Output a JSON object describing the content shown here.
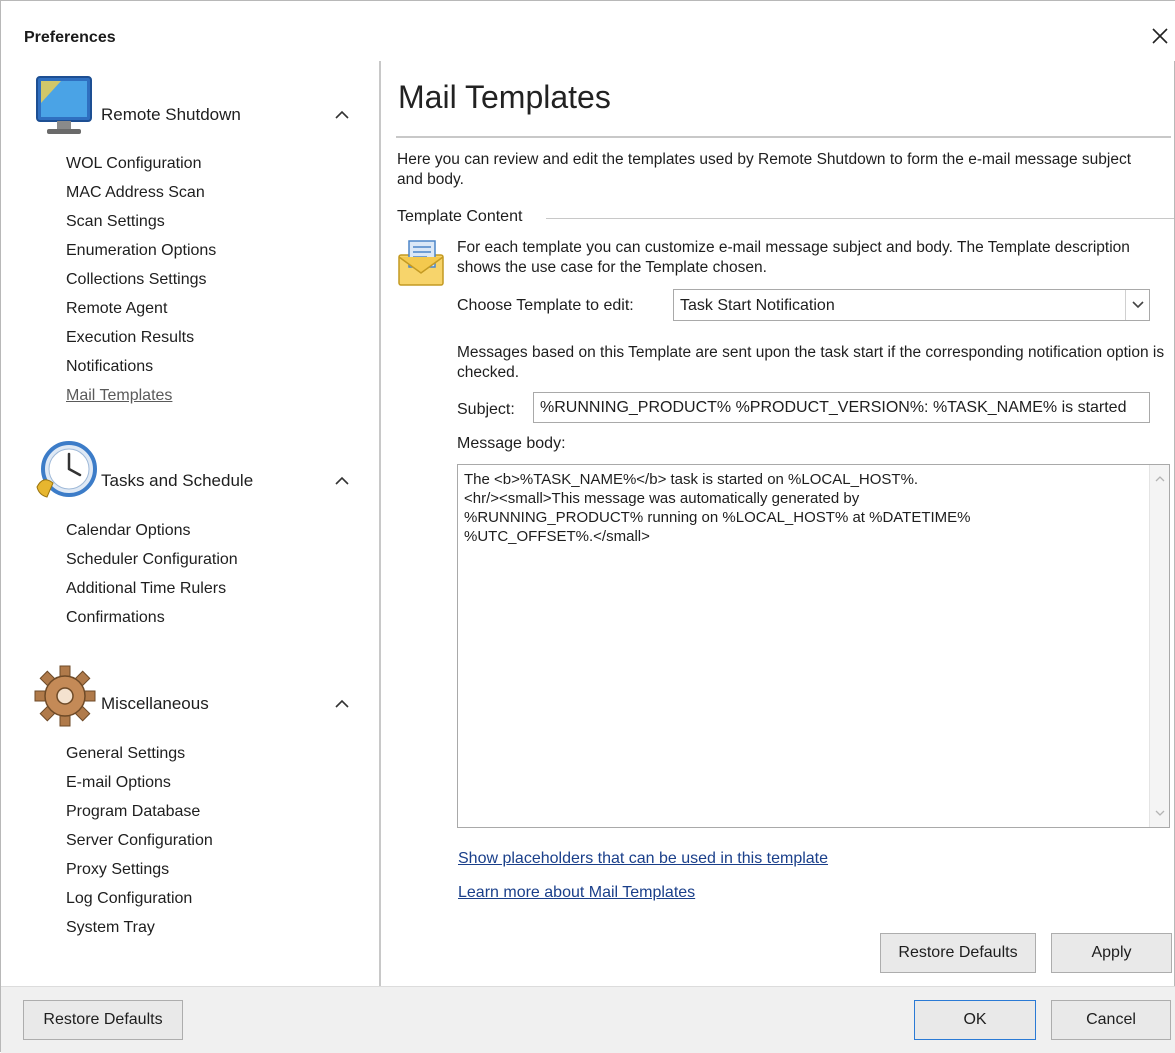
{
  "window": {
    "title": "Preferences"
  },
  "sidebar": {
    "groups": [
      {
        "label": "Remote Shutdown",
        "icon": "monitor-icon",
        "items": [
          "WOL Configuration",
          "MAC Address Scan",
          "Scan Settings",
          "Enumeration Options",
          "Collections Settings",
          "Remote Agent",
          "Execution Results",
          "Notifications",
          "Mail Templates"
        ]
      },
      {
        "label": "Tasks and Schedule",
        "icon": "clock-icon",
        "items": [
          "Calendar Options",
          "Scheduler Configuration",
          "Additional Time Rulers",
          "Confirmations"
        ]
      },
      {
        "label": "Miscellaneous",
        "icon": "gear-icon",
        "items": [
          "General Settings",
          "E-mail Options",
          "Program Database",
          "Server Configuration",
          "Proxy Settings",
          "Log Configuration",
          "System Tray"
        ]
      }
    ],
    "active_item": "Mail Templates"
  },
  "main": {
    "title": "Mail Templates",
    "intro": "Here you can review and edit the templates used by Remote Shutdown to form the e-mail message subject and body.",
    "section_label": "Template Content",
    "description": "For each template you can customize e-mail message subject and body. The Template description shows the use case for the Template chosen.",
    "choose_label": "Choose Template to edit:",
    "selected_template": "Task Start Notification",
    "message_description": "Messages based on this Template are sent upon the task start if the corresponding notification option is checked.",
    "subject_label": "Subject:",
    "subject_value": "%RUNNING_PRODUCT% %PRODUCT_VERSION%: %TASK_NAME% is started",
    "body_label": "Message body:",
    "body_value": "The <b>%TASK_NAME%</b> task is started on %LOCAL_HOST%.\n<hr/><small>This message was automatically generated by\n%RUNNING_PRODUCT% running on %LOCAL_HOST% at %DATETIME%\n%UTC_OFFSET%.</small>",
    "link_placeholders": "Show placeholders that can be used in this template",
    "link_learn_more": "Learn more about Mail Templates",
    "restore_defaults_label": "Restore Defaults",
    "apply_label": "Apply"
  },
  "footer": {
    "restore_defaults_label": "Restore Defaults",
    "ok_label": "OK",
    "cancel_label": "Cancel"
  },
  "colors": {
    "link": "#1a3f8a",
    "primary_border": "#2a7ad5",
    "footer_bg": "#f0f0f0"
  }
}
